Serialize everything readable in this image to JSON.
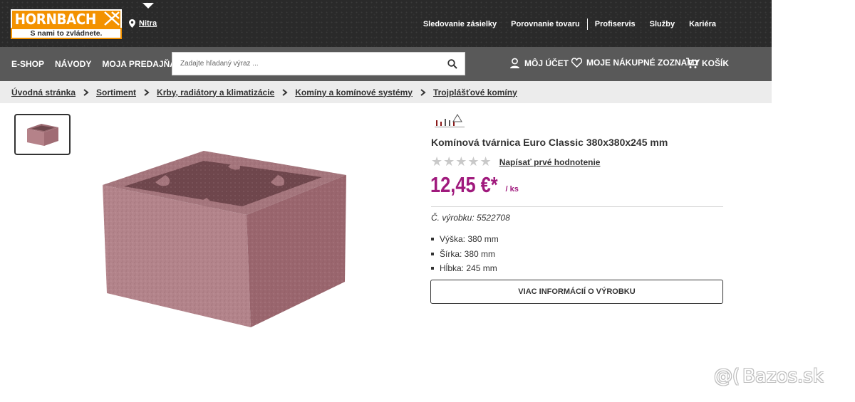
{
  "header": {
    "logo_text": "HORNBACH",
    "logo_slogan": "S nami to zvládnete.",
    "store": "Nitra",
    "links": [
      "Sledovanie zásielky",
      "Porovnanie tovaru",
      "Profiservis",
      "Služby",
      "Kariéra"
    ]
  },
  "nav": {
    "items": [
      "E-SHOP",
      "NÁVODY",
      "MOJA PREDAJŇA"
    ],
    "search_placeholder": "Zadajte hľadaný výraz ...",
    "account": "MÔJ ÚČET",
    "lists": "MOJE NÁKUPNÉ ZOZNAMY",
    "cart": "KOŠÍK"
  },
  "breadcrumb": [
    "Úvodná stránka",
    "Sortiment",
    "Krby, radiátory a klimatizácie",
    "Komíny a komínové systémy",
    "Trojplášťové komíny"
  ],
  "product": {
    "title": "Komínová tvárnica Euro Classic 380x380x245 mm",
    "stars": "★★★★★",
    "rating_link": "Napísať prvé hodnotenie",
    "price": "12,45 €*",
    "unit": "/ ks",
    "article_no": "Č. výrobku: 5522708",
    "specs": [
      "Výška: 380 mm",
      "Šírka: 380 mm",
      "Hĺbka: 245 mm"
    ],
    "more_button": "VIAC INFORMÁCIÍ O VÝROBKU"
  },
  "watermark": {
    "symbol": "@(",
    "text": "Bazos.sk"
  },
  "colors": {
    "accent": "#f39200",
    "price": "#a01a7d",
    "header_bg": "#2a2a2a",
    "nav_bg": "#595959"
  }
}
